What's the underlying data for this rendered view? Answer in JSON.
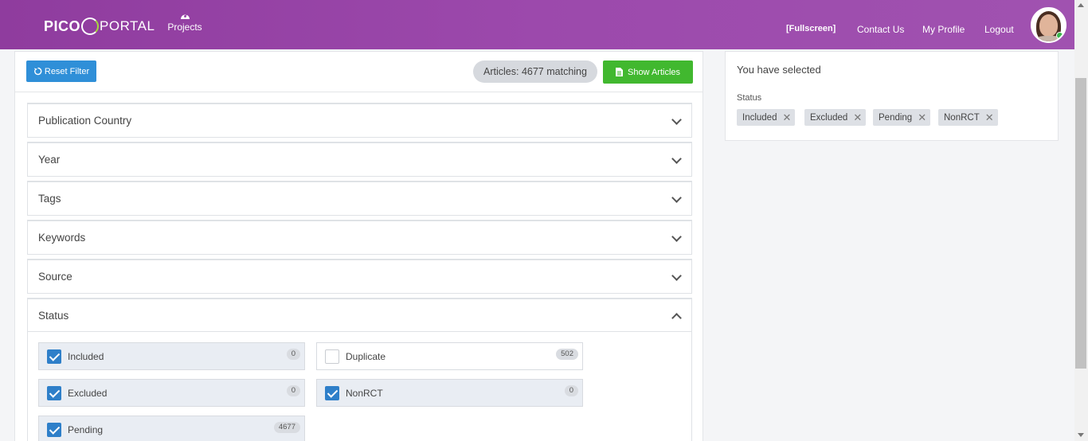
{
  "header": {
    "logo_left": "PICO",
    "logo_right": "PORTAL",
    "projects_label": "Projects",
    "fullscreen_label": "[Fullscreen]",
    "contact_label": "Contact Us",
    "profile_label": "My Profile",
    "logout_label": "Logout"
  },
  "toolbar": {
    "reset_label": "Reset Filter",
    "matching_label": "Articles: 4677 matching",
    "show_label": "Show Articles"
  },
  "filters": {
    "publication_country": "Publication Country",
    "year": "Year",
    "tags": "Tags",
    "keywords": "Keywords",
    "source": "Source",
    "status": "Status"
  },
  "status_options": [
    {
      "label": "Included",
      "count": "0",
      "checked": true
    },
    {
      "label": "Duplicate",
      "count": "502",
      "checked": false
    },
    {
      "label": "Excluded",
      "count": "0",
      "checked": true
    },
    {
      "label": "NonRCT",
      "count": "0",
      "checked": true
    },
    {
      "label": "Pending",
      "count": "4677",
      "checked": true
    }
  ],
  "selected_panel": {
    "title": "You have selected",
    "group_label": "Status",
    "chips": [
      "Included",
      "Excluded",
      "Pending",
      "NonRCT"
    ]
  },
  "colors": {
    "header_gradient_start": "#8f3c9e",
    "header_gradient_end": "#a052b0",
    "reset_button": "#2f8fd8",
    "show_button": "#41b82f",
    "checkbox_on": "#2e7fc9"
  }
}
